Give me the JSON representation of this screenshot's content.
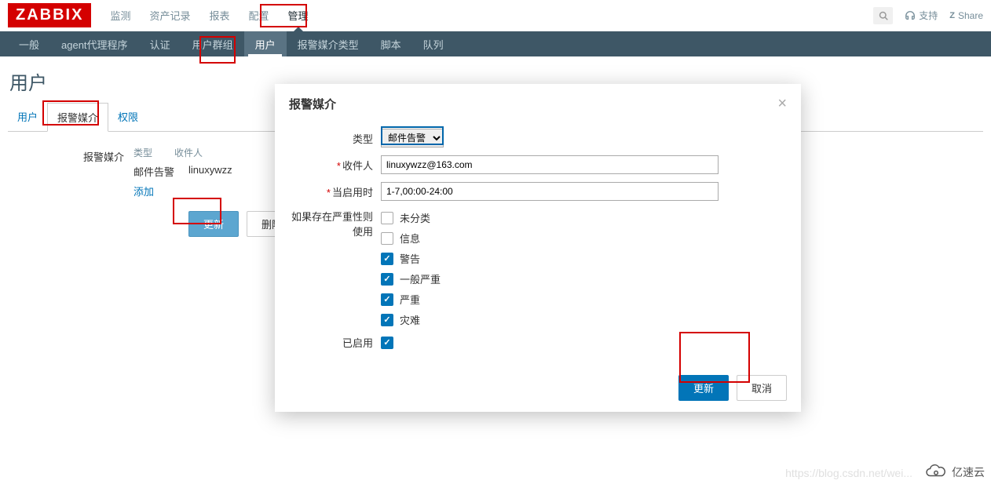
{
  "logo": "ZABBIX",
  "top_nav": {
    "items": [
      "监测",
      "资产记录",
      "报表",
      "配置",
      "管理"
    ],
    "active_index": 4
  },
  "top_right": {
    "support": "支持",
    "share": "Share",
    "share_icon": "Z"
  },
  "sub_nav": {
    "items": [
      "一般",
      "agent代理程序",
      "认证",
      "用户群组",
      "用户",
      "报警媒介类型",
      "脚本",
      "队列"
    ],
    "active_index": 4
  },
  "page_title": "用户",
  "tabs": {
    "items": [
      "用户",
      "报警媒介",
      "权限"
    ],
    "active_index": 1
  },
  "content": {
    "section_label": "报警媒介",
    "headers": {
      "type": "类型",
      "recipient": "收件人"
    },
    "row": {
      "type": "邮件告警",
      "recipient": "linuxywzz"
    },
    "add_link": "添加",
    "update_btn": "更新",
    "delete_btn": "删除"
  },
  "modal": {
    "title": "报警媒介",
    "labels": {
      "type": "类型",
      "recipient": "收件人",
      "when_active": "当启用时",
      "severity": "如果存在严重性则使用",
      "enabled": "已启用"
    },
    "type_value": "邮件告警",
    "recipient_value": "linuxywzz@163.com",
    "when_active_value": "1-7,00:00-24:00",
    "severities": [
      {
        "label": "未分类",
        "checked": false
      },
      {
        "label": "信息",
        "checked": false
      },
      {
        "label": "警告",
        "checked": true
      },
      {
        "label": "一般严重",
        "checked": true
      },
      {
        "label": "严重",
        "checked": true
      },
      {
        "label": "灾难",
        "checked": true
      }
    ],
    "enabled_checked": true,
    "update_btn": "更新",
    "cancel_btn": "取消"
  },
  "watermark": "https://blog.csdn.net/wei...",
  "bottom_badge": "亿速云"
}
